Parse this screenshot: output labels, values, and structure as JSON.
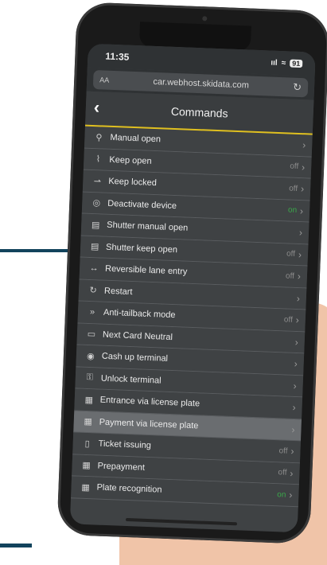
{
  "colors": {
    "accent": "#e0c020",
    "on_state": "#3aa94a",
    "brand_line": "#12435c"
  },
  "status": {
    "time": "11:35",
    "signal": "ııl",
    "wifi": "≈",
    "battery": "91"
  },
  "browser": {
    "aa": "AA",
    "url": "car.webhost.skidata.com",
    "reload_icon": "reload-icon"
  },
  "header": {
    "back": "‹",
    "title": "Commands"
  },
  "commands": [
    {
      "icon": "⚲",
      "icon_name": "manual-open-icon",
      "label": "Manual open",
      "state": ""
    },
    {
      "icon": "⌇",
      "icon_name": "keep-open-icon",
      "label": "Keep open",
      "state": "off"
    },
    {
      "icon": "⇀",
      "icon_name": "keep-locked-icon",
      "label": "Keep locked",
      "state": "off"
    },
    {
      "icon": "◎",
      "icon_name": "deactivate-icon",
      "label": "Deactivate device",
      "state": "on"
    },
    {
      "icon": "▤",
      "icon_name": "shutter-icon",
      "label": "Shutter manual open",
      "state": ""
    },
    {
      "icon": "▤",
      "icon_name": "shutter-keep-icon",
      "label": "Shutter keep open",
      "state": "off"
    },
    {
      "icon": "↔",
      "icon_name": "reversible-lane-icon",
      "label": "Reversible lane entry",
      "state": "off"
    },
    {
      "icon": "↻",
      "icon_name": "restart-icon",
      "label": "Restart",
      "state": ""
    },
    {
      "icon": "»",
      "icon_name": "anti-tailback-icon",
      "label": "Anti-tailback mode",
      "state": "off"
    },
    {
      "icon": "▭",
      "icon_name": "card-icon",
      "label": "Next Card Neutral",
      "state": ""
    },
    {
      "icon": "◉",
      "icon_name": "cash-up-icon",
      "label": "Cash up terminal",
      "state": ""
    },
    {
      "icon": "⚿",
      "icon_name": "unlock-icon",
      "label": "Unlock terminal",
      "state": ""
    },
    {
      "icon": "▦",
      "icon_name": "license-plate-icon",
      "label": "Entrance via license plate",
      "state": ""
    },
    {
      "icon": "▦",
      "icon_name": "payment-plate-icon",
      "label": "Payment via license plate",
      "state": ""
    },
    {
      "icon": "▯",
      "icon_name": "ticket-icon",
      "label": "Ticket issuing",
      "state": "off"
    },
    {
      "icon": "▦",
      "icon_name": "prepayment-icon",
      "label": "Prepayment",
      "state": "off"
    },
    {
      "icon": "▦",
      "icon_name": "plate-recognition-icon",
      "label": "Plate recognition",
      "state": "on"
    }
  ],
  "highlighted_index": 13
}
